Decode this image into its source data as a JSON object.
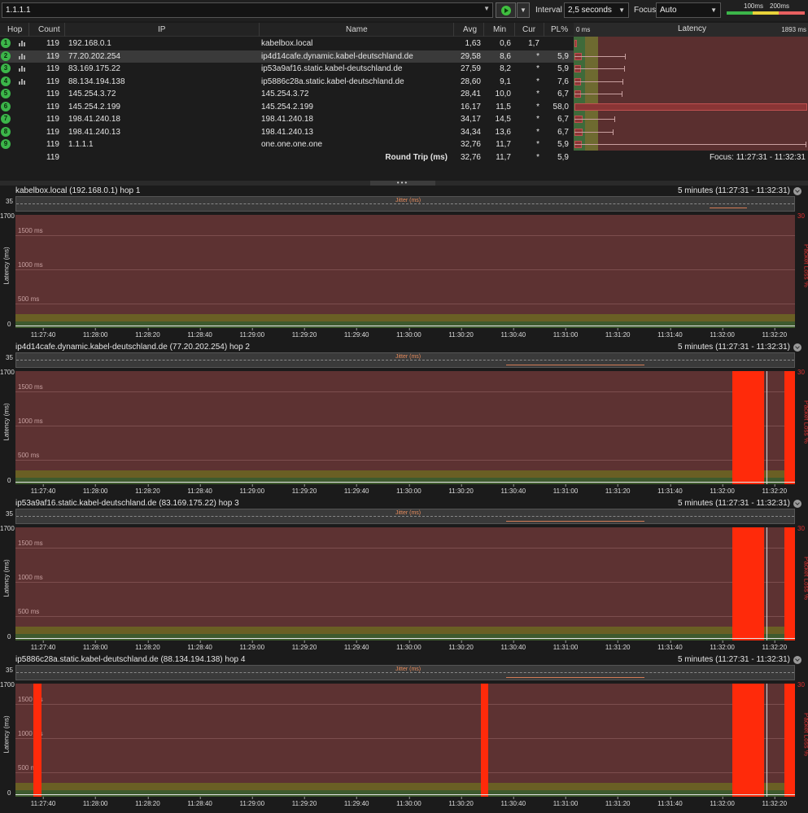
{
  "toolbar": {
    "target": "1.1.1.1",
    "interval_label": "Interval",
    "interval_value": "2,5 seconds",
    "focus_label": "Focus",
    "focus_value": "Auto",
    "legend_100": "100ms",
    "legend_200": "200ms",
    "colors": {
      "good": "#3cb64a",
      "warn": "#e8d23a",
      "bad": "#e86060"
    }
  },
  "table": {
    "headers": {
      "hop": "Hop",
      "count": "Count",
      "ip": "IP",
      "name": "Name",
      "avg": "Avg",
      "min": "Min",
      "cur": "Cur",
      "pl": "PL%",
      "latency": "Latency"
    },
    "latency_min": "0 ms",
    "latency_max": "1893 ms",
    "latency_scale_max_ms": 1893,
    "rows": [
      {
        "hop": "1",
        "count": "119",
        "ip": "192.168.0.1",
        "name": "kabelbox.local",
        "avg": "1,63",
        "min": "0,6",
        "cur": "1,7",
        "pl": "",
        "icon": true,
        "avg_ms": 1.63,
        "max_ms": 4
      },
      {
        "hop": "2",
        "count": "119",
        "ip": "77.20.202.254",
        "name": "ip4d14cafe.dynamic.kabel-deutschland.de",
        "avg": "29,58",
        "min": "8,6",
        "cur": "*",
        "pl": "5,9",
        "icon": true,
        "avg_ms": 29.58,
        "max_ms": 540
      },
      {
        "hop": "3",
        "count": "119",
        "ip": "83.169.175.22",
        "name": "ip53a9af16.static.kabel-deutschland.de",
        "avg": "27,59",
        "min": "8,2",
        "cur": "*",
        "pl": "5,9",
        "icon": true,
        "avg_ms": 27.59,
        "max_ms": 525
      },
      {
        "hop": "4",
        "count": "119",
        "ip": "88.134.194.138",
        "name": "ip5886c28a.static.kabel-deutschland.de",
        "avg": "28,60",
        "min": "9,1",
        "cur": "*",
        "pl": "7,6",
        "icon": true,
        "avg_ms": 28.6,
        "max_ms": 510
      },
      {
        "hop": "5",
        "count": "119",
        "ip": "145.254.3.72",
        "name": "145.254.3.72",
        "avg": "28,41",
        "min": "10,0",
        "cur": "*",
        "pl": "6,7",
        "icon": false,
        "avg_ms": 28.41,
        "max_ms": 495
      },
      {
        "hop": "6",
        "count": "119",
        "ip": "145.254.2.199",
        "name": "145.254.2.199",
        "avg": "16,17",
        "min": "11,5",
        "cur": "*",
        "pl": "58,0",
        "icon": false,
        "avg_ms": 16.17,
        "max_ms": 20
      },
      {
        "hop": "7",
        "count": "119",
        "ip": "198.41.240.18",
        "name": "198.41.240.18",
        "avg": "34,17",
        "min": "14,5",
        "cur": "*",
        "pl": "6,7",
        "icon": false,
        "avg_ms": 34.17,
        "max_ms": 385
      },
      {
        "hop": "8",
        "count": "119",
        "ip": "198.41.240.13",
        "name": "198.41.240.13",
        "avg": "34,34",
        "min": "13,6",
        "cur": "*",
        "pl": "6,7",
        "icon": false,
        "avg_ms": 34.34,
        "max_ms": 350
      },
      {
        "hop": "9",
        "count": "119",
        "ip": "1.1.1.1",
        "name": "one.one.one.one",
        "avg": "32,76",
        "min": "11,7",
        "cur": "*",
        "pl": "5,9",
        "icon": false,
        "avg_ms": 32.76,
        "max_ms": 1893
      }
    ],
    "round_trip": {
      "count": "119",
      "label": "Round Trip (ms)",
      "avg": "32,76",
      "min": "11,7",
      "cur": "*",
      "pl": "5,9",
      "focus": "Focus: 11:27:31 - 11:32:31"
    }
  },
  "chart_data": [
    {
      "type": "bar",
      "title": "kabelbox.local (192.168.0.1) hop 1",
      "range": "5 minutes (11:27:31 - 11:32:31)",
      "jitter_label": "Jitter (ms)",
      "jitter_max": "35",
      "ylabel": "Latency (ms)",
      "y2label": "Packet Loss %",
      "ymax": "1700",
      "y2max": "30",
      "grid": [
        "1500 ms",
        "1000 ms",
        "500 ms"
      ],
      "ymin": "0",
      "xticks": [
        "11:27:40",
        "11:28:00",
        "11:28:20",
        "11:28:40",
        "11:29:00",
        "11:29:20",
        "11:29:40",
        "11:30:00",
        "11:30:20",
        "11:30:40",
        "11:31:00",
        "11:31:20",
        "11:31:40",
        "11:32:00",
        "11:32:20"
      ],
      "packet_loss": []
    },
    {
      "type": "bar",
      "title": "ip4d14cafe.dynamic.kabel-deutschland.de (77.20.202.254) hop 2",
      "range": "5 minutes (11:27:31 - 11:32:31)",
      "jitter_label": "Jitter (ms)",
      "jitter_max": "35",
      "ylabel": "Latency (ms)",
      "y2label": "Packet Loss %",
      "ymax": "1700",
      "y2max": "30",
      "grid": [
        "1500 ms",
        "1000 ms",
        "500 ms"
      ],
      "ymin": "0",
      "xticks": [
        "11:27:40",
        "11:28:00",
        "11:28:20",
        "11:28:40",
        "11:29:00",
        "11:29:20",
        "11:29:40",
        "11:30:00",
        "11:30:20",
        "11:30:40",
        "11:31:00",
        "11:31:20",
        "11:31:40",
        "11:32:00",
        "11:32:20"
      ],
      "packet_loss": [
        {
          "from_s": 276,
          "to_s": 288
        },
        {
          "from_s": 296,
          "to_s": 301
        }
      ]
    },
    {
      "type": "bar",
      "title": "ip53a9af16.static.kabel-deutschland.de (83.169.175.22) hop 3",
      "range": "5 minutes (11:27:31 - 11:32:31)",
      "jitter_label": "Jitter (ms)",
      "jitter_max": "35",
      "ylabel": "Latency (ms)",
      "y2label": "Packet Loss %",
      "ymax": "1700",
      "y2max": "30",
      "grid": [
        "1500 ms",
        "1000 ms",
        "500 ms"
      ],
      "ymin": "0",
      "xticks": [
        "11:27:40",
        "11:28:00",
        "11:28:20",
        "11:28:40",
        "11:29:00",
        "11:29:20",
        "11:29:40",
        "11:30:00",
        "11:30:20",
        "11:30:40",
        "11:31:00",
        "11:31:20",
        "11:31:40",
        "11:32:00",
        "11:32:20"
      ],
      "packet_loss": [
        {
          "from_s": 276,
          "to_s": 288
        },
        {
          "from_s": 296,
          "to_s": 301
        }
      ]
    },
    {
      "type": "bar",
      "title": "ip5886c28a.static.kabel-deutschland.de (88.134.194.138) hop 4",
      "range": "5 minutes (11:27:31 - 11:32:31)",
      "jitter_label": "Jitter (ms)",
      "jitter_max": "35",
      "ylabel": "Latency (ms)",
      "y2label": "Packet Loss %",
      "ymax": "1700",
      "y2max": "30",
      "grid": [
        "1500 ms",
        "1000 ms",
        "500 ms"
      ],
      "ymin": "0",
      "xticks": [
        "11:27:40",
        "11:28:00",
        "11:28:20",
        "11:28:40",
        "11:29:00",
        "11:29:20",
        "11:29:40",
        "11:30:00",
        "11:30:20",
        "11:30:40",
        "11:31:00",
        "11:31:20",
        "11:31:40",
        "11:32:00",
        "11:32:20"
      ],
      "packet_loss": [
        {
          "from_s": 7,
          "to_s": 10
        },
        {
          "from_s": 179,
          "to_s": 182
        },
        {
          "from_s": 276,
          "to_s": 288
        },
        {
          "from_s": 296,
          "to_s": 301
        }
      ]
    }
  ]
}
